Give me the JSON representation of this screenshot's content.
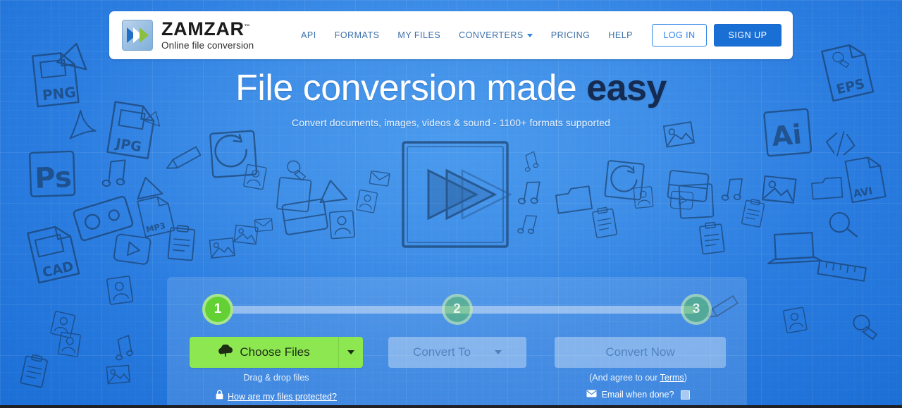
{
  "header": {
    "logo": {
      "name": "ZAMZAR",
      "tm": "™",
      "tagline": "Online file conversion",
      "icon": "double-chevron-logo-icon"
    },
    "nav": [
      {
        "label": "API",
        "icon": ""
      },
      {
        "label": "FORMATS",
        "icon": ""
      },
      {
        "label": "MY FILES",
        "icon": ""
      },
      {
        "label": "CONVERTERS",
        "icon": "chevron-down-icon"
      },
      {
        "label": "PRICING",
        "icon": ""
      },
      {
        "label": "HELP",
        "icon": ""
      }
    ],
    "login_label": "LOG IN",
    "signup_label": "SIGN UP"
  },
  "hero": {
    "headline_plain": "File conversion made ",
    "headline_bold": "easy",
    "subhead": "Convert documents, images, videos & sound - 1100+ formats supported",
    "illustration_icon": "sketched-fast-forward-logo-icon"
  },
  "converter": {
    "steps": [
      {
        "number": "1",
        "state": "active"
      },
      {
        "number": "2",
        "state": "idle"
      },
      {
        "number": "3",
        "state": "idle"
      }
    ],
    "choose_files_label": "Choose Files",
    "choose_files_icon": "cloud-upload-icon",
    "choose_files_caret_icon": "caret-down-icon",
    "convert_to_label": "Convert To",
    "convert_to_caret_icon": "caret-down-icon",
    "convert_now_label": "Convert Now",
    "drag_drop_note": "Drag & drop files",
    "protected_icon": "lock-icon",
    "protected_link": "How are my files protected?",
    "terms_prefix": "(And agree to our ",
    "terms_link": "Terms",
    "terms_suffix": ")",
    "email_icon": "envelope-icon",
    "email_label": "Email when done?",
    "email_checked": false
  },
  "colors": {
    "background_blue": "#2b7de0",
    "brand_blue": "#1a6fd4",
    "nav_link": "#3b6fa8",
    "accent_green": "#8ce751",
    "step_active_green": "#63d033",
    "headline_bold": "#152b52",
    "panel_overlay": "rgba(255,255,255,0.13)"
  },
  "doodles": [
    "png-file-doodle",
    "jpg-file-doodle",
    "photoshop-doodle",
    "cad-file-doodle",
    "eps-file-doodle",
    "illustrator-doodle",
    "avi-file-doodle",
    "music-note-doodle",
    "cassette-tape-doodle",
    "pencil-doodle",
    "wrench-doodle",
    "envelope-doodle",
    "play-button-doodle",
    "refresh-doodle",
    "image-doodle",
    "code-brackets-doodle",
    "mp3-file-doodle",
    "clipboard-doodle",
    "laptop-doodle",
    "ruler-doodle",
    "magnifier-doodle",
    "folder-doodle",
    "document-doodle",
    "video-doodle"
  ]
}
